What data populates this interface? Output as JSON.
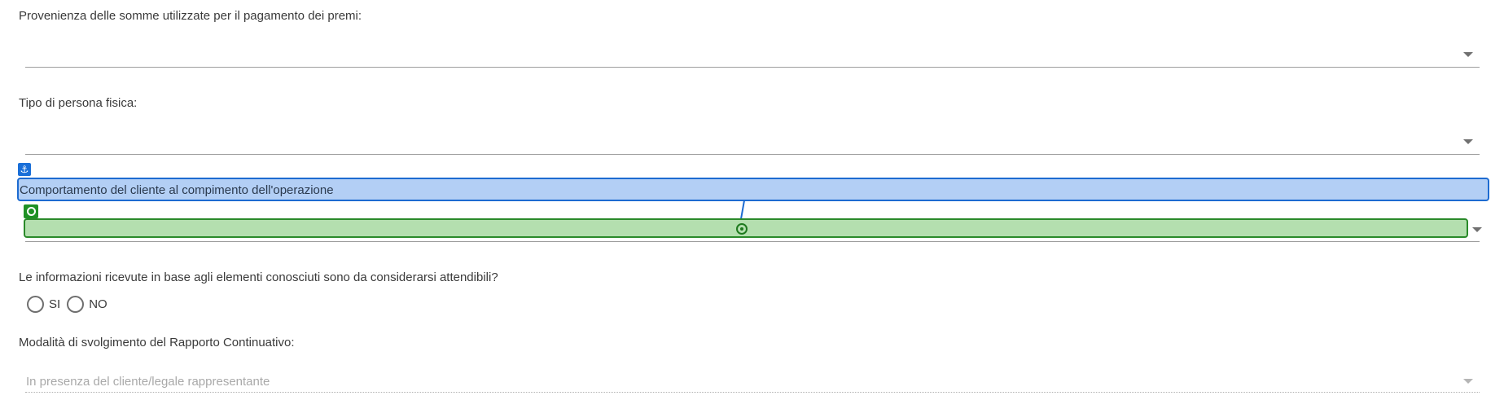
{
  "fields": {
    "provenienza": {
      "label": "Provenienza delle somme utilizzate per il pagamento dei premi:",
      "value": ""
    },
    "tipo_persona": {
      "label": "Tipo di persona fisica:",
      "value": ""
    },
    "comportamento": {
      "label": "Comportamento del cliente al compimento dell'operazione",
      "value": ""
    },
    "attendibili": {
      "label": "Le informazioni ricevute in base agli elementi conosciuti sono da considerarsi attendibili?",
      "options": [
        "SI",
        "NO"
      ],
      "selected": null
    },
    "modalita": {
      "label": "Modalità di svolgimento del Rapporto Continuativo:",
      "value": "In presenza del cliente/legale rappresentante"
    }
  },
  "overlay": {
    "anchor_icon": "anchor-icon",
    "target_icon": "target-icon",
    "crosshair_icon": "crosshair-icon",
    "anchor_color": "#1d6bd1",
    "target_color": "#2a8a2a"
  }
}
